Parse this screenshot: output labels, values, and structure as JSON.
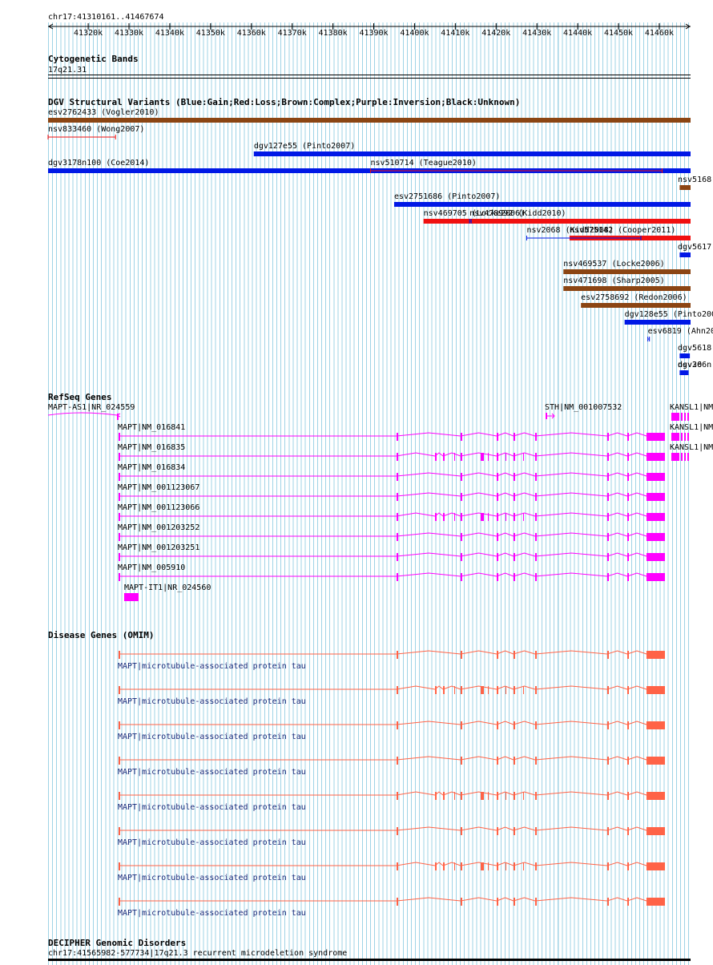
{
  "location": "chr17:41310161..41467674",
  "view": {
    "start": 41310161,
    "end": 41467674
  },
  "ruler": {
    "ticks": [
      {
        "label": "41320k",
        "pos": 41320000
      },
      {
        "label": "41330k",
        "pos": 41330000
      },
      {
        "label": "41340k",
        "pos": 41340000
      },
      {
        "label": "41350k",
        "pos": 41350000
      },
      {
        "label": "41360k",
        "pos": 41360000
      },
      {
        "label": "41370k",
        "pos": 41370000
      },
      {
        "label": "41380k",
        "pos": 41380000
      },
      {
        "label": "41390k",
        "pos": 41390000
      },
      {
        "label": "41400k",
        "pos": 41400000
      },
      {
        "label": "41410k",
        "pos": 41410000
      },
      {
        "label": "41420k",
        "pos": 41420000
      },
      {
        "label": "41430k",
        "pos": 41430000
      },
      {
        "label": "41440k",
        "pos": 41440000
      },
      {
        "label": "41450k",
        "pos": 41450000
      },
      {
        "label": "41460k",
        "pos": 41460000
      }
    ]
  },
  "colors": {
    "gain": "#0018e6",
    "loss": "#f01010",
    "complex": "#8b4513",
    "refseq": "#ff00ff",
    "omim": "#ff6347",
    "omim_label": "#1a2a7a",
    "grid": "#9fd3e6"
  },
  "cyto": {
    "title": "Cytogenetic Bands",
    "band": "17q21.31"
  },
  "dgv": {
    "title": "DGV Structural Variants (Blue:Gain;Red:Loss;Brown:Complex;Purple:Inversion;Black:Unknown)",
    "items": [
      {
        "label": "esv2762433 (Vogler2010)",
        "start": 41310161,
        "end": 41467674,
        "type": "complex",
        "style": "thick"
      },
      {
        "label": "nsv833460 (Wong2007)",
        "start": 41310161,
        "end": 41326700,
        "type": "loss",
        "style": "thin"
      },
      {
        "label": "dgv127e55 (Pinto2007)",
        "start": 41360600,
        "end": 41467674,
        "type": "gain",
        "style": "thick"
      },
      {
        "label": "dgv3178n100 (Coe2014)",
        "start": 41310161,
        "end": 41467674,
        "type": "gain",
        "style": "thick"
      },
      {
        "label": "nsv510714 (Teague2010)",
        "start": 41389200,
        "end": 41460700,
        "type": "loss",
        "style": "thin"
      },
      {
        "label": "nsv5168",
        "start": 41465000,
        "end": 41467674,
        "type": "complex",
        "style": "thick"
      },
      {
        "label": "esv2751686 (Pinto2007)",
        "start": 41395000,
        "end": 41467674,
        "type": "gain",
        "style": "thick"
      },
      {
        "label": "nsv469705 (Locke2006)",
        "start": 41402200,
        "end": 41467674,
        "type": "loss",
        "style": "thick"
      },
      {
        "label": "nsv478992 (Kidd2010)",
        "start": 41413500,
        "end": 41413800,
        "type": "gain",
        "style": "thin"
      },
      {
        "label": "nsv575142 (Cooper2011)",
        "start": 41438000,
        "end": 41467674,
        "type": "loss",
        "style": "thick"
      },
      {
        "label": "nsv2068 (Kidd2008)",
        "start": 41427500,
        "end": 41455500,
        "type": "gain",
        "style": "thin"
      },
      {
        "label": "dgv5617",
        "start": 41465000,
        "end": 41467674,
        "type": "gain",
        "style": "thick"
      },
      {
        "label": "nsv469537 (Locke2006)",
        "start": 41436500,
        "end": 41467674,
        "type": "complex",
        "style": "thick"
      },
      {
        "label": "nsv471698 (Sharp2005)",
        "start": 41436500,
        "end": 41467674,
        "type": "complex",
        "style": "thick"
      },
      {
        "label": "esv2758692 (Redon2006)",
        "start": 41440800,
        "end": 41467674,
        "type": "complex",
        "style": "thick"
      },
      {
        "label": "dgv128e55 (Pinto2007",
        "start": 41451500,
        "end": 41467674,
        "type": "gain",
        "style": "thick"
      },
      {
        "label": "esv6819 (Ahn200",
        "start": 41457200,
        "end": 41457500,
        "type": "gain",
        "style": "thin"
      },
      {
        "label": "dgv5618",
        "start": 41465000,
        "end": 41467500,
        "type": "gain",
        "style": "thick"
      },
      {
        "label": "dgv366n",
        "start": 41465000,
        "end": 41467000,
        "type": "gain",
        "style": "thick"
      },
      {
        "label": "nsv20",
        "start": 41466700,
        "end": 41467000,
        "type": "gain",
        "style": "thin"
      }
    ]
  },
  "refseq": {
    "title": "RefSeq Genes",
    "mapt_as1": {
      "label": "MAPT-AS1|NR_024559",
      "start": 41310161,
      "end": 41328000
    },
    "sth": {
      "label": "STH|NM_001007532"
    },
    "kansl1": [
      "KANSL1|NM",
      "KANSL1|NM",
      "KANSL1|NM"
    ],
    "mapt": [
      {
        "label": "MAPT|NM_016841",
        "variant": "a"
      },
      {
        "label": "MAPT|NM_016835",
        "variant": "b"
      },
      {
        "label": "MAPT|NM_016834",
        "variant": "a"
      },
      {
        "label": "MAPT|NM_001123067",
        "variant": "a"
      },
      {
        "label": "MAPT|NM_001123066",
        "variant": "b"
      },
      {
        "label": "MAPT|NM_001203252",
        "variant": "a"
      },
      {
        "label": "MAPT|NM_001203251",
        "variant": "a"
      },
      {
        "label": "MAPT|NM_005910",
        "variant": "a"
      }
    ],
    "mapt_it1": {
      "label": "MAPT-IT1|NR_024560"
    }
  },
  "omim": {
    "title": "Disease Genes (OMIM)",
    "items": [
      {
        "label": "MAPT|microtubule-associated protein tau",
        "variant": "a"
      },
      {
        "label": "MAPT|microtubule-associated protein tau",
        "variant": "b"
      },
      {
        "label": "MAPT|microtubule-associated protein tau",
        "variant": "a"
      },
      {
        "label": "MAPT|microtubule-associated protein tau",
        "variant": "a"
      },
      {
        "label": "MAPT|microtubule-associated protein tau",
        "variant": "b"
      },
      {
        "label": "MAPT|microtubule-associated protein tau",
        "variant": "a"
      },
      {
        "label": "MAPT|microtubule-associated protein tau",
        "variant": "b"
      },
      {
        "label": "MAPT|microtubule-associated protein tau",
        "variant": "a"
      }
    ]
  },
  "decipher": {
    "title": "DECIPHER Genomic Disorders",
    "item": "chr17:41565982-577734|17q21.3 recurrent microdeletion syndrome"
  }
}
